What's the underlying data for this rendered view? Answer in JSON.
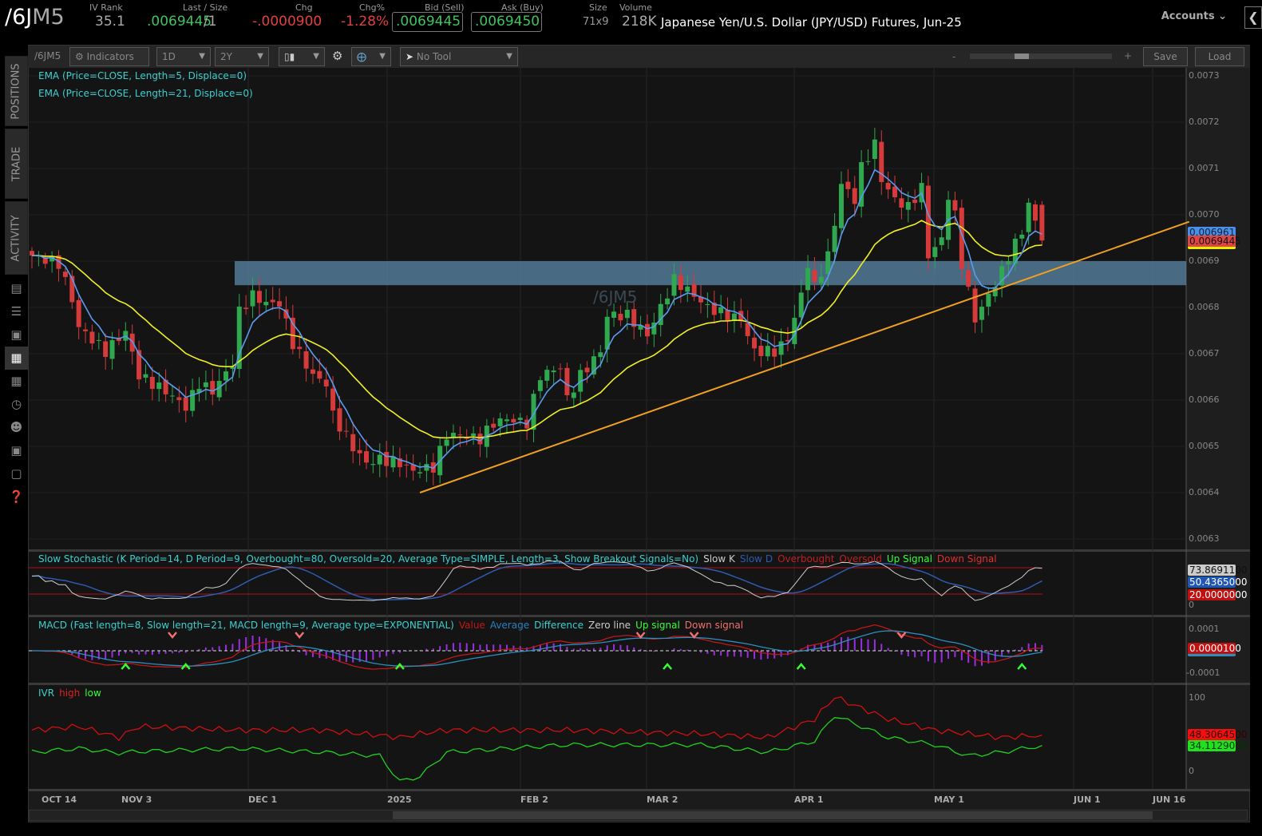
{
  "header": {
    "symbol_main": "/6J",
    "symbol_rest": "M5",
    "iv_rank_label": "IV Rank",
    "iv_rank": "35.1",
    "last_label": "Last / Size",
    "last": ".0069445",
    "size_suffix": "/1",
    "chg_label": "Chg",
    "chg": "-.0000900",
    "chgp_label": "Chg%",
    "chgp": "-1.28%",
    "bid_label": "Bid (Sell)",
    "bid": ".0069445",
    "ask_label": "Ask (Buy)",
    "ask": ".0069450",
    "size_label": "Size",
    "size": "71x9",
    "volume_label": "Volume",
    "volume": "218K",
    "description": "Japanese Yen/U.S. Dollar (JPY/USD) Futures, Jun-25",
    "accounts": "Accounts"
  },
  "sidebar": {
    "tabs": [
      "POSITIONS",
      "TRADE",
      "ACTIVITY"
    ],
    "icons": [
      "news-icon",
      "list-icon",
      "tv-icon",
      "chart-icon",
      "grid-icon",
      "clock-icon",
      "people-icon",
      "calendar-icon",
      "fx-icon",
      "help-icon"
    ]
  },
  "toolbar": {
    "symbol": "/6JM5",
    "indicators": "Indicators",
    "aggregation": "1D",
    "timeframe": "2Y",
    "tool": "No Tool",
    "save": "Save",
    "load": "Load"
  },
  "studies": {
    "ema5": "EMA (Price=CLOSE, Length=5, Displace=0)",
    "ema21": "EMA (Price=CLOSE, Length=21, Displace=0)",
    "stoch": "Slow Stochastic (K Period=14, D Period=9, Overbought=80, Oversold=20, Average Type=SIMPLE, Length=3, Show Breakout Signals=No)",
    "stoch_legend": [
      "Slow K",
      "Slow D",
      "Overbought",
      "Oversold",
      "Up Signal",
      "Down Signal"
    ],
    "macd": "MACD (Fast length=8, Slow length=21, MACD length=9, Average type=EXPONENTIAL)",
    "macd_legend": [
      "Value",
      "Average",
      "Difference",
      "Zero line",
      "Up signal",
      "Down signal"
    ],
    "ivr": "IVR",
    "ivr_legend": [
      "high",
      "low"
    ]
  },
  "watermark": "/6JM5",
  "colors": {
    "up": "#2fa84f",
    "down": "#d63b3b",
    "ema5": "#5b9bf0",
    "ema21": "#f0f020",
    "trend": "#f0a020",
    "zone": "#5b87a8"
  },
  "chart_data": [
    {
      "type": "candlestick",
      "title": "/6JM5 daily",
      "ylim": [
        0.0063,
        0.0073
      ],
      "yticks": [
        "0.0073",
        "0.0072",
        "0.0071",
        "0.0070",
        "0.0069",
        "0.0068",
        "0.0067",
        "0.0066",
        "0.0065",
        "0.0064",
        "0.0063"
      ],
      "xticks": [
        "OCT 14",
        "NOV 3",
        "DEC 1",
        "2025",
        "FEB 2",
        "MAR 2",
        "APR 1",
        "MAY 1",
        "JUN 1",
        "JUN 16"
      ],
      "close_anchors": [
        [
          0,
          0.006912
        ],
        [
          4,
          0.006895
        ],
        [
          6,
          0.006817
        ],
        [
          7,
          0.006757
        ],
        [
          11,
          0.006705
        ],
        [
          14,
          0.006748
        ],
        [
          16,
          0.006653
        ],
        [
          20,
          0.006619
        ],
        [
          23,
          0.006585
        ],
        [
          25,
          0.006636
        ],
        [
          27,
          0.006619
        ],
        [
          30,
          0.006679
        ],
        [
          31,
          0.006791
        ],
        [
          33,
          0.006826
        ],
        [
          35,
          0.006809
        ],
        [
          37,
          0.006809
        ],
        [
          39,
          0.006722
        ],
        [
          42,
          0.006653
        ],
        [
          44,
          0.006636
        ],
        [
          45,
          0.006567
        ],
        [
          48,
          0.006498
        ],
        [
          50,
          0.006464
        ],
        [
          52,
          0.006472
        ],
        [
          55,
          0.006464
        ],
        [
          57,
          0.006447
        ],
        [
          60,
          0.006455
        ],
        [
          62,
          0.006524
        ],
        [
          64,
          0.006524
        ],
        [
          67,
          0.006516
        ],
        [
          69,
          0.00655
        ],
        [
          71,
          0.006559
        ],
        [
          74,
          0.00655
        ],
        [
          76,
          0.006653
        ],
        [
          79,
          0.006671
        ],
        [
          80,
          0.006602
        ],
        [
          82,
          0.006653
        ],
        [
          85,
          0.006705
        ],
        [
          86,
          0.006783
        ],
        [
          89,
          0.006783
        ],
        [
          92,
          0.00674
        ],
        [
          94,
          0.0068
        ],
        [
          96,
          0.00686
        ],
        [
          99,
          0.006826
        ],
        [
          101,
          0.0068
        ],
        [
          104,
          0.006783
        ],
        [
          106,
          0.006774
        ],
        [
          108,
          0.006705
        ],
        [
          111,
          0.006705
        ],
        [
          113,
          0.006731
        ],
        [
          115,
          0.006826
        ],
        [
          116,
          0.006895
        ],
        [
          117,
          0.006843
        ],
        [
          119,
          0.006912
        ],
        [
          120,
          0.006981
        ],
        [
          121,
          0.007067
        ],
        [
          123,
          0.007033
        ],
        [
          124,
          0.007102
        ],
        [
          126,
          0.007153
        ],
        [
          127,
          0.007076
        ],
        [
          129,
          0.007033
        ],
        [
          131,
          0.007016
        ],
        [
          133,
          0.007059
        ],
        [
          134,
          0.006912
        ],
        [
          136,
          0.006947
        ],
        [
          137,
          0.007041
        ],
        [
          138,
          0.006998
        ],
        [
          139,
          0.006895
        ],
        [
          141,
          0.006774
        ],
        [
          143,
          0.006826
        ],
        [
          145,
          0.006878
        ],
        [
          146,
          0.006912
        ],
        [
          148,
          0.006964
        ],
        [
          149,
          0.007024
        ],
        [
          151,
          0.0069445
        ]
      ],
      "support_zone": [
        0.006848,
        0.0069
      ],
      "trendline": {
        "start": [
          58,
          0.0064
        ],
        "end": [
          173,
          0.006985
        ]
      },
      "price_tags": {
        "ema5": "0.0069615",
        "last": "0.0069445"
      }
    },
    {
      "type": "line",
      "title": "Slow Stochastic",
      "ylim": [
        0,
        100
      ],
      "overbought": 80,
      "oversold": 20,
      "yticks": [
        "0"
      ],
      "tags": {
        "k": "73.8691100",
        "d": "50.4365000",
        "os": "20.0000000"
      }
    },
    {
      "type": "line",
      "title": "MACD",
      "ylim": [
        -0.00013,
        0.00013
      ],
      "yticks": [
        "0.0001",
        "-0.0001"
      ],
      "tags": {
        "value": "0.0000100"
      },
      "up_signals": [
        14,
        23,
        55,
        95,
        115,
        148
      ],
      "down_signals": [
        21,
        40,
        91,
        99,
        130
      ]
    },
    {
      "type": "line",
      "title": "IVR",
      "ylim": [
        0,
        100
      ],
      "yticks": [
        "100",
        "0"
      ],
      "tags": {
        "high": "48.3064500",
        "low": "34.1129000"
      },
      "anchors": [
        [
          0,
          55,
          25
        ],
        [
          7,
          60,
          30
        ],
        [
          13,
          45,
          24
        ],
        [
          16,
          60,
          26
        ],
        [
          31,
          55,
          30
        ],
        [
          43,
          55,
          25
        ],
        [
          52,
          48,
          20
        ],
        [
          55,
          45,
          -15
        ],
        [
          58,
          50,
          -8
        ],
        [
          62,
          55,
          25
        ],
        [
          80,
          55,
          35
        ],
        [
          100,
          50,
          35
        ],
        [
          110,
          45,
          25
        ],
        [
          117,
          70,
          40
        ],
        [
          120,
          100,
          75
        ],
        [
          124,
          85,
          60
        ],
        [
          128,
          70,
          45
        ],
        [
          135,
          55,
          35
        ],
        [
          140,
          50,
          20
        ],
        [
          145,
          45,
          25
        ],
        [
          151,
          48.3,
          34.1
        ]
      ]
    }
  ]
}
